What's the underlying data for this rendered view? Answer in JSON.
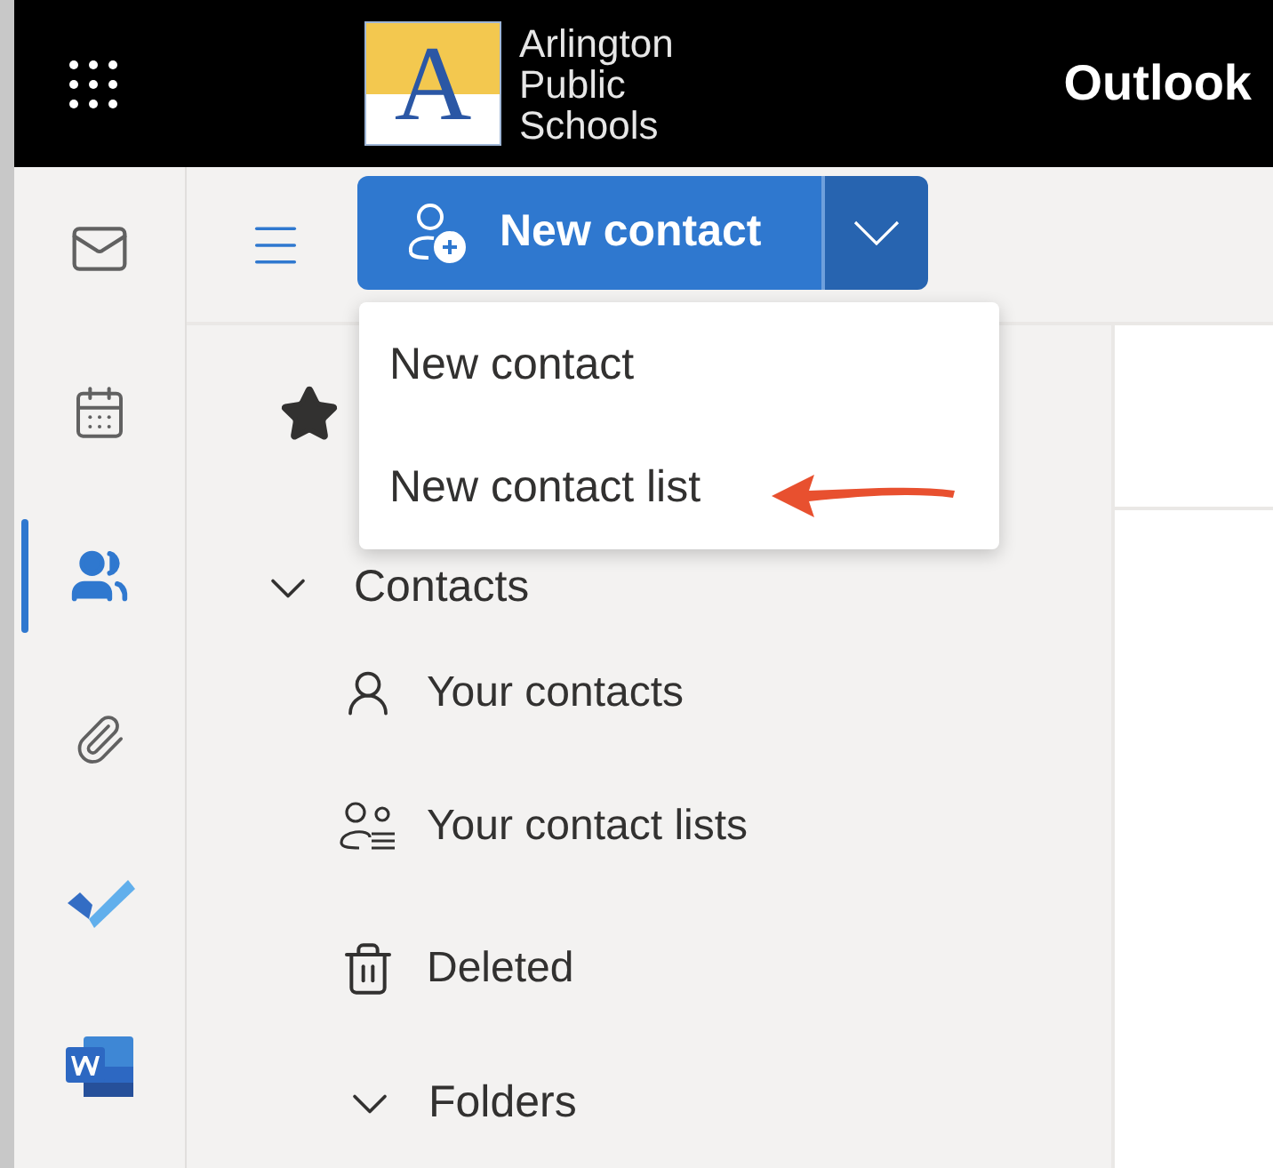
{
  "header": {
    "logo_letter": "A",
    "logo_lines": [
      "Arlington",
      "Public",
      "Schools"
    ],
    "app_name": "Outlook"
  },
  "rail": [
    {
      "kind": "mail",
      "selected": false
    },
    {
      "kind": "calendar",
      "selected": false
    },
    {
      "kind": "people",
      "selected": true
    },
    {
      "kind": "files",
      "selected": false
    },
    {
      "kind": "todo",
      "selected": false
    },
    {
      "kind": "word",
      "selected": false
    }
  ],
  "toolbar": {
    "new_button": "New contact"
  },
  "menu": {
    "items": [
      "New contact",
      "New contact list"
    ]
  },
  "nav": [
    {
      "kind": "favorites"
    },
    {
      "kind": "group",
      "label": "Contacts",
      "expanded": true
    },
    {
      "kind": "contacts",
      "label": "Your contacts"
    },
    {
      "kind": "lists",
      "label": "Your contact lists"
    },
    {
      "kind": "deleted",
      "label": "Deleted"
    },
    {
      "kind": "group",
      "label": "Folders",
      "expanded": true
    }
  ]
}
